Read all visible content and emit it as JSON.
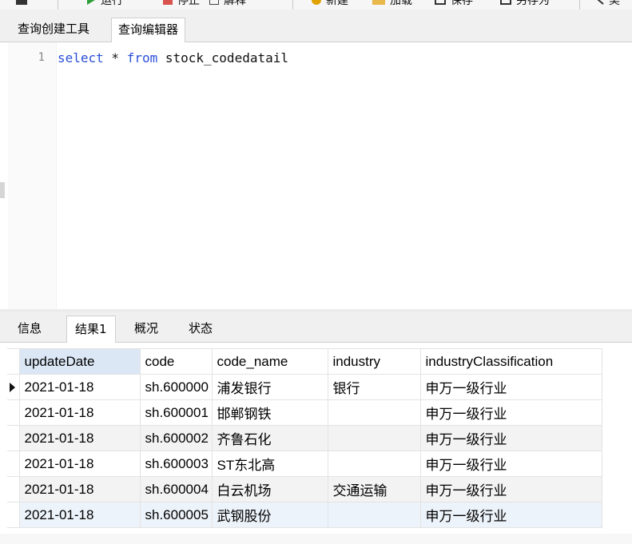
{
  "toolbar": {
    "items": [
      {
        "label": "运行",
        "icon": "play-icon",
        "color": "#2e9e3b"
      },
      {
        "label": "停止",
        "icon": "stop-icon",
        "color": "#d9534f"
      },
      {
        "label": "解释",
        "icon": "explain-icon",
        "color": "#444444"
      },
      {
        "label": "新建",
        "icon": "new-icon",
        "color": "#e0a200"
      },
      {
        "label": "加载",
        "icon": "folder-icon",
        "color": "#e8b84a"
      },
      {
        "label": "保存",
        "icon": "save-icon",
        "color": "#333333"
      },
      {
        "label": "另存为",
        "icon": "save-as-icon",
        "color": "#333333"
      },
      {
        "label": "美",
        "icon": "beautify-icon",
        "color": "#333333"
      }
    ]
  },
  "query_tabs": [
    {
      "label": "查询创建工具",
      "active": false
    },
    {
      "label": "查询编辑器",
      "active": true
    }
  ],
  "editor": {
    "line_number": "1",
    "tokens": [
      {
        "text": "select",
        "type": "keyword"
      },
      {
        "text": " * ",
        "type": "plain"
      },
      {
        "text": "from",
        "type": "keyword"
      },
      {
        "text": " stock_codedatail",
        "type": "plain"
      }
    ]
  },
  "result_tabs": [
    {
      "label": "信息",
      "active": false
    },
    {
      "label": "结果1",
      "active": true
    },
    {
      "label": "概况",
      "active": false
    },
    {
      "label": "状态",
      "active": false
    }
  ],
  "grid": {
    "columns": [
      "updateDate",
      "code",
      "code_name",
      "industry",
      "industryClassification"
    ],
    "rows": [
      [
        "2021-01-18",
        "sh.600000",
        "浦发银行",
        "银行",
        "申万一级行业"
      ],
      [
        "2021-01-18",
        "sh.600001",
        "邯郸钢铁",
        "",
        "申万一级行业"
      ],
      [
        "2021-01-18",
        "sh.600002",
        "齐鲁石化",
        "",
        "申万一级行业"
      ],
      [
        "2021-01-18",
        "sh.600003",
        "ST东北高",
        "",
        "申万一级行业"
      ],
      [
        "2021-01-18",
        "sh.600004",
        "白云机场",
        "交通运输",
        "申万一级行业"
      ],
      [
        "2021-01-18",
        "sh.600005",
        "武钢股份",
        "",
        "申万一级行业"
      ]
    ],
    "current_row": 0
  }
}
